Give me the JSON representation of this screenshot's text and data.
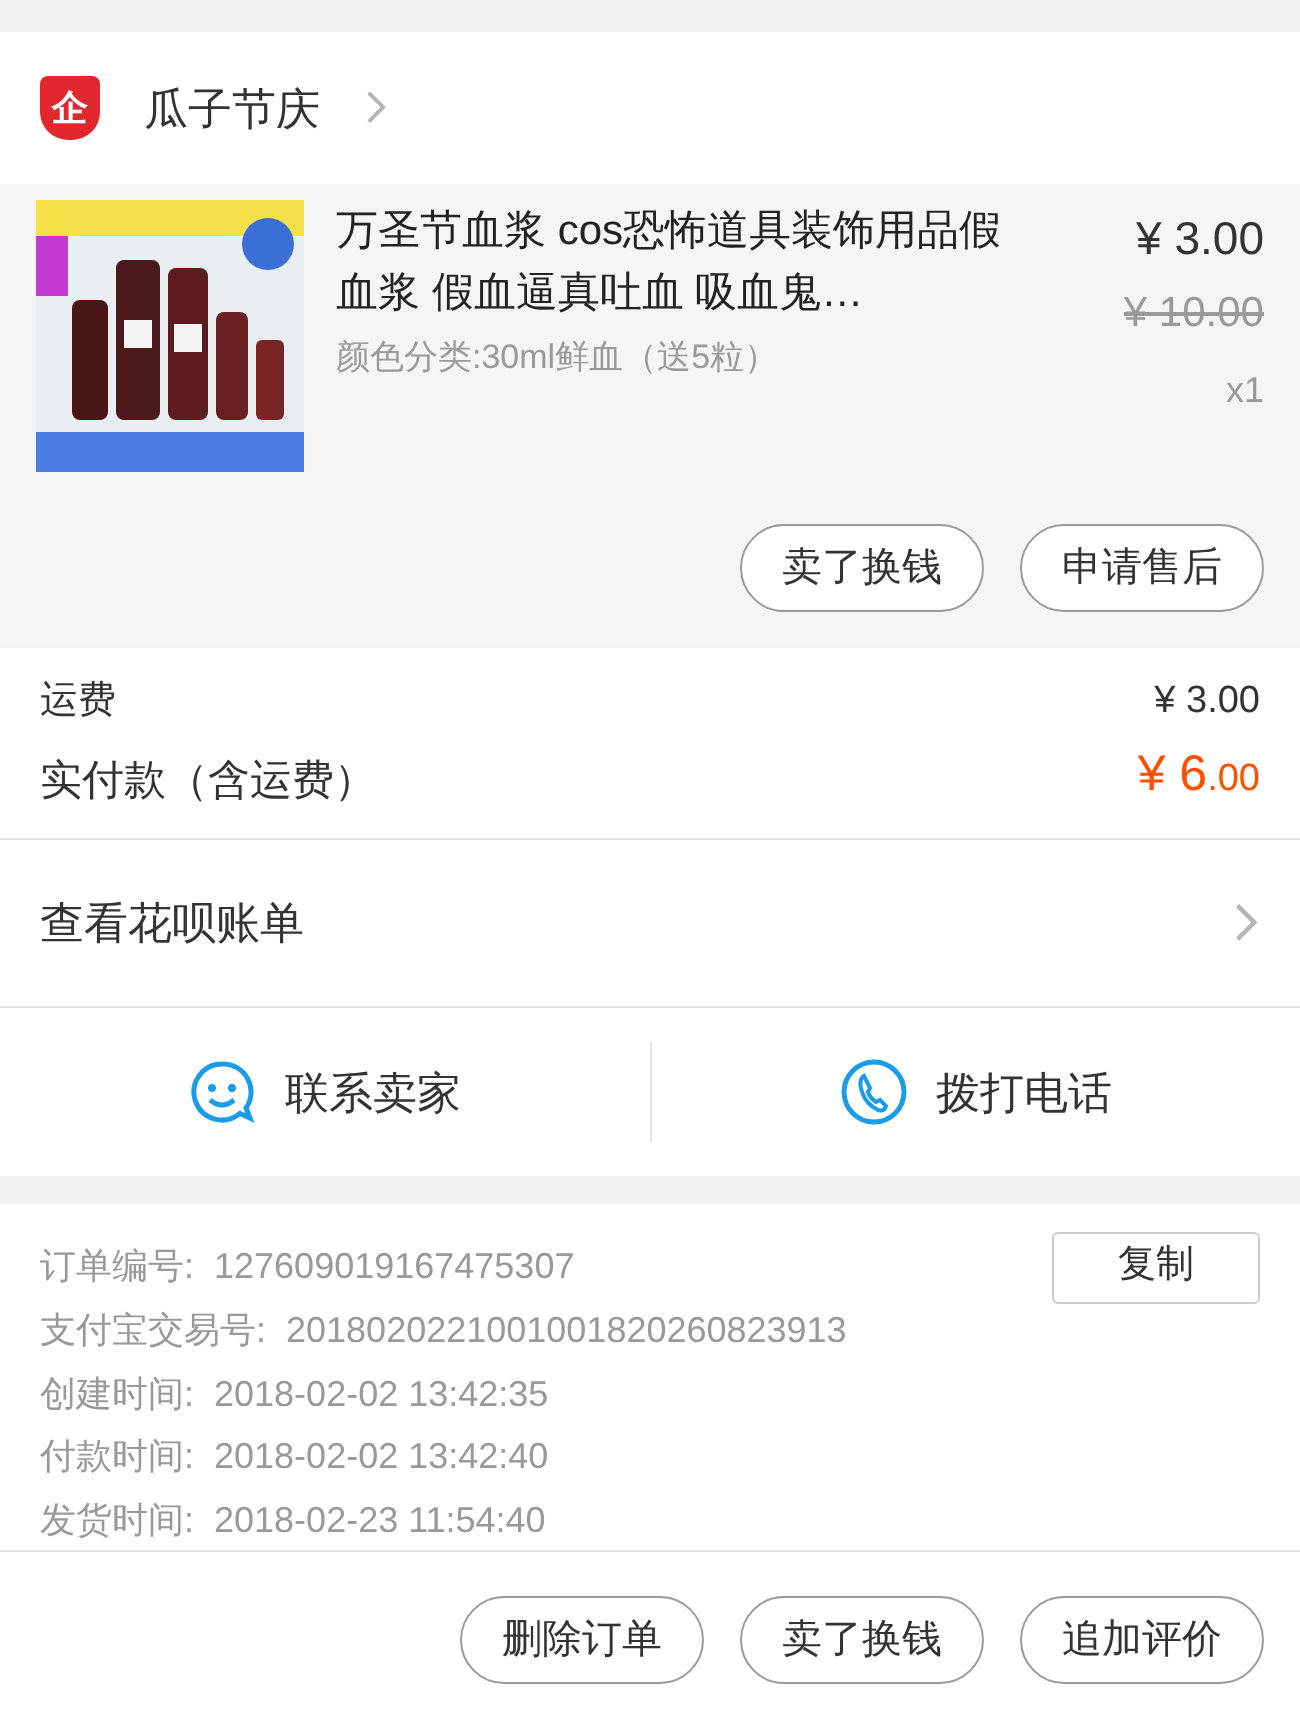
{
  "shop": {
    "name": "瓜子节庆",
    "badge": "企"
  },
  "product": {
    "kind": "picture",
    "title": "万圣节血浆 cos恐怖道具装饰用品假血浆 假血逼真吐血 吸血鬼…",
    "variant": "颜色分类:30ml鲜血（送5粒）",
    "price": "¥ 3.00",
    "original_price": "¥ 10.00",
    "quantity": "x1",
    "buttons": [
      "卖了换钱",
      "申请售后"
    ]
  },
  "fees": {
    "shipping_label": "运费",
    "shipping_value": "¥ 3.00",
    "total_label": "实付款（含运费）",
    "total_whole": "¥ 6",
    "total_fraction": ".00"
  },
  "bill_link": {
    "label": "查看花呗账单"
  },
  "contact": [
    {
      "kind": "chat",
      "label": "联系卖家"
    },
    {
      "kind": "phone",
      "label": "拨打电话"
    }
  ],
  "order_info": [
    {
      "label": "订单编号:",
      "value": "127609019167475307",
      "action": "复制"
    },
    {
      "label": "支付宝交易号:",
      "value": "2018020221001001820260823913"
    },
    {
      "label": "创建时间:",
      "value": "2018-02-02 13:42:35"
    },
    {
      "label": "付款时间:",
      "value": "2018-02-02 13:42:40"
    },
    {
      "label": "发货时间:",
      "value": "2018-02-23 11:54:40"
    }
  ],
  "bottom_buttons": [
    "删除订单",
    "卖了换钱",
    "追加评价"
  ]
}
